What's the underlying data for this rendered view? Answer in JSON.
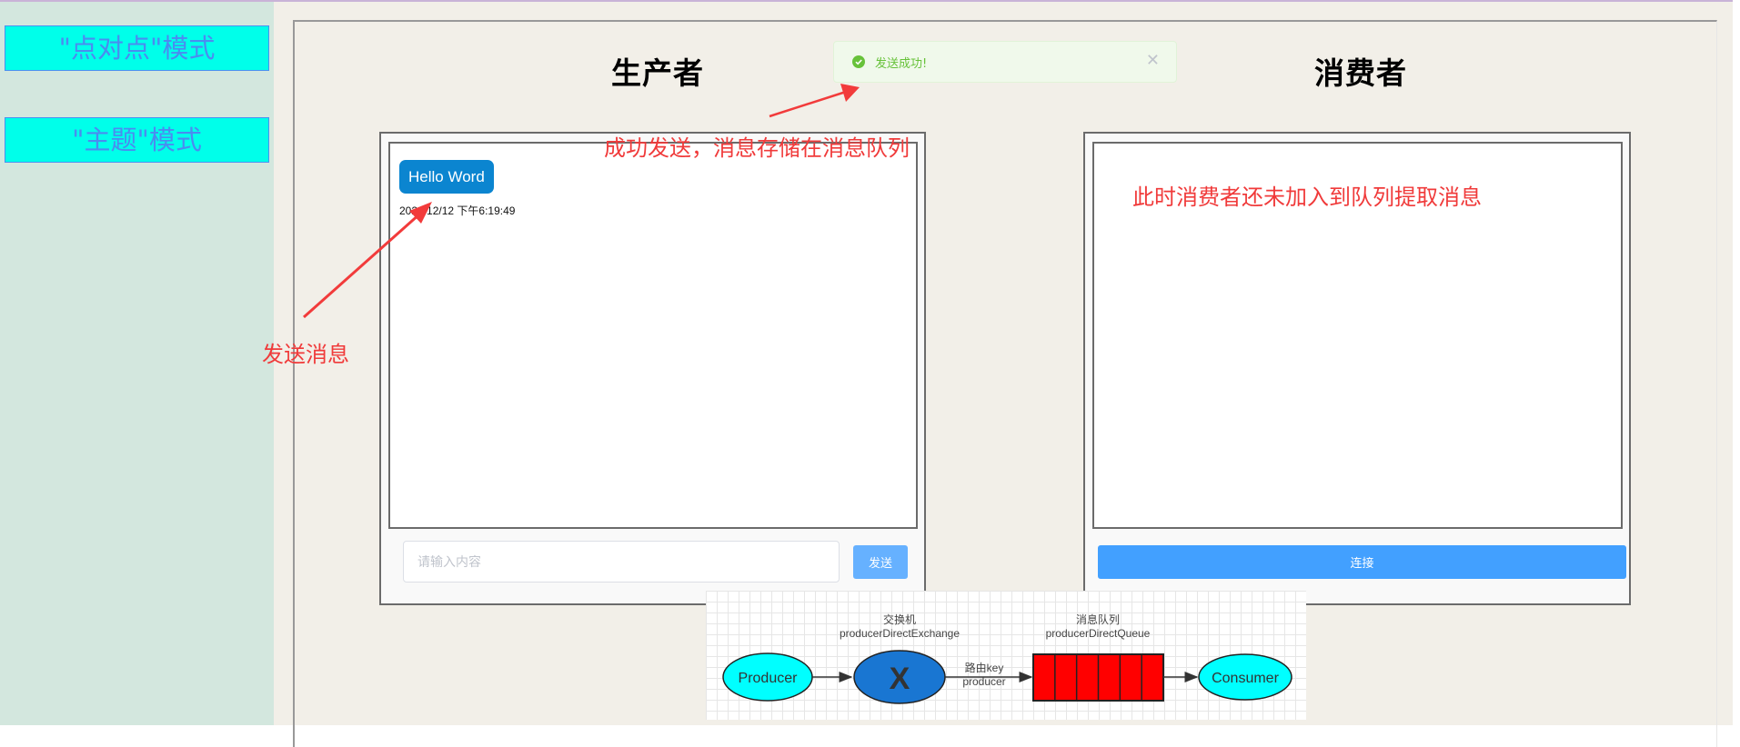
{
  "sidebar": {
    "modes": [
      {
        "label": "\"点对点\"模式"
      },
      {
        "label": "\"主题\"模式"
      }
    ]
  },
  "producer": {
    "title": "生产者",
    "messages": [
      {
        "text": "Hello Word",
        "timestamp": "2021/12/12 下午6:19:49"
      }
    ],
    "input": {
      "value": "",
      "placeholder": "请输入内容"
    },
    "send_label": "发送"
  },
  "consumer": {
    "title": "消费者",
    "connect_label": "连接"
  },
  "toast": {
    "type": "success",
    "message": "发送成功!",
    "close_icon": "close-icon"
  },
  "annotations": {
    "send_message": "发送消息",
    "sent_success": "成功发送，消息存储在消息队列",
    "consumer_not_joined": "此时消费者还未加入到队列提取消息"
  },
  "diagram": {
    "producer_label": "Producer",
    "exchange_symbol": "X",
    "exchange_caption": "交换机",
    "exchange_name": "producerDirectExchange",
    "routing_caption": "路由key",
    "routing_key": "producer",
    "queue_caption": "消息队列",
    "queue_name": "producerDirectQueue",
    "queue_slots": 6,
    "consumer_label": "Consumer"
  },
  "colors": {
    "mode_button_bg": "#00ffea",
    "mode_button_text": "#4a8cf0",
    "bubble": "#0b85d0",
    "send_button": "#66b1ff",
    "connect_button": "#42a0ff",
    "toast_success": "#67c23a",
    "annotation": "#f03a3a",
    "queue": "#ff0000",
    "exchange": "#1976d2",
    "endpoint": "#00ffff"
  }
}
